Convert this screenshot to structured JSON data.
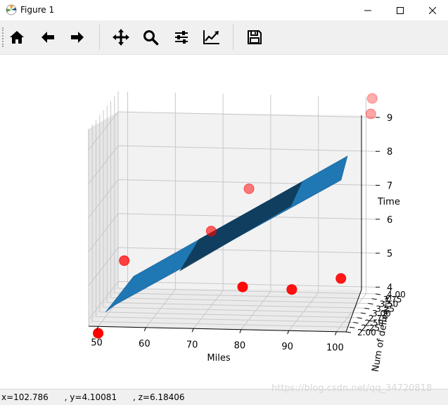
{
  "window": {
    "title": "Figure 1",
    "controls": [
      "minimize",
      "maximize",
      "close"
    ]
  },
  "toolbar": {
    "buttons": [
      {
        "name": "home",
        "icon": "home-icon"
      },
      {
        "name": "back",
        "icon": "arrow-left-icon"
      },
      {
        "name": "forward",
        "icon": "arrow-right-icon"
      },
      {
        "name": "pan",
        "icon": "move-icon"
      },
      {
        "name": "zoom",
        "icon": "search-icon"
      },
      {
        "name": "configure-subplots",
        "icon": "sliders-icon"
      },
      {
        "name": "edit-axis",
        "icon": "chart-line-icon"
      },
      {
        "name": "save",
        "icon": "floppy-disk-icon"
      }
    ]
  },
  "status": {
    "text": "x=102.786      , y=4.10081      , z=6.18406"
  },
  "watermark": "https://blog.csdn.net/qq_34720818",
  "chart_data": {
    "type": "scatter",
    "projection": "3d",
    "xlabel": "Miles",
    "ylabel": "Num of deliverys",
    "zlabel": "Time",
    "x_ticks": [
      "50",
      "60",
      "70",
      "80",
      "90",
      "100"
    ],
    "y_ticks": [
      "2.00",
      "2.25",
      "2.50",
      "2.75",
      "3.00",
      "3.25",
      "3.50",
      "3.75",
      "4.00"
    ],
    "z_ticks": [
      "4",
      "5",
      "6",
      "7",
      "8",
      "9"
    ],
    "xlim": [
      48,
      102
    ],
    "ylim": [
      2.0,
      4.0
    ],
    "zlim": [
      3.8,
      9.6
    ],
    "points_color": "#ff0000",
    "surface_color": "#1f77b4",
    "points": [
      {
        "miles": 50,
        "deliveries": 2.0,
        "time": 3.6
      },
      {
        "miles": 53,
        "deliveries": 2.8,
        "time": 5.3
      },
      {
        "miles": 70,
        "deliveries": 3.2,
        "time": 6.0
      },
      {
        "miles": 77,
        "deliveries": 3.5,
        "time": 7.1
      },
      {
        "miles": 80,
        "deliveries": 2.1,
        "time": 5.0
      },
      {
        "miles": 90,
        "deliveries": 2.2,
        "time": 4.9
      },
      {
        "miles": 100,
        "deliveries": 2.3,
        "time": 5.2
      },
      {
        "miles": 101,
        "deliveries": 4.0,
        "time": 9.1
      },
      {
        "miles": 101,
        "deliveries": 4.1,
        "time": 9.5
      }
    ],
    "grid": true
  }
}
